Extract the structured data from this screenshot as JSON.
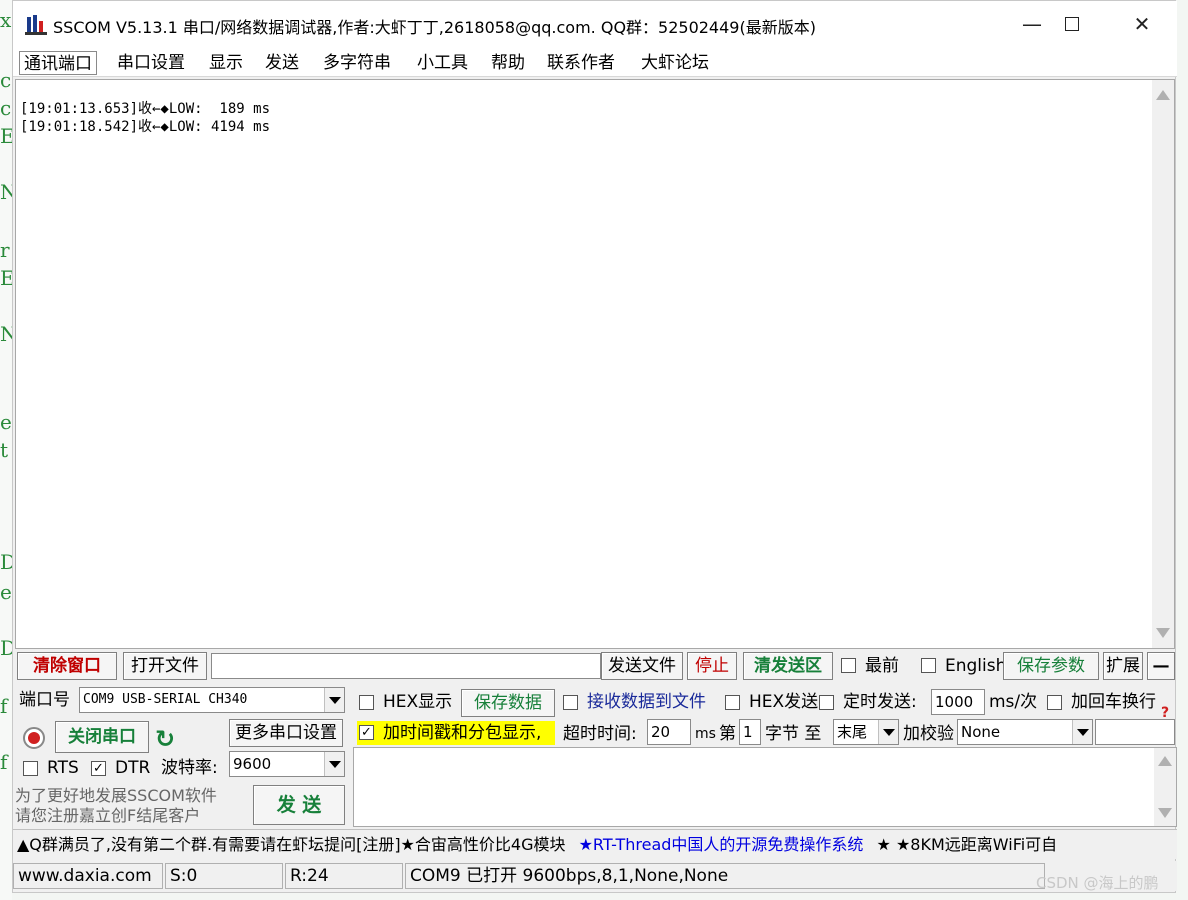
{
  "background_editor": {
    "left_chars": [
      "x",
      "c",
      "c",
      "E",
      "N",
      "r",
      "E",
      "N",
      "e",
      "t",
      "D",
      "e",
      "D",
      "f",
      "f"
    ]
  },
  "window": {
    "title": "SSCOM V5.13.1 串口/网络数据调试器,作者:大虾丁丁,2618058@qq.com. QQ群：52502449(最新版本)",
    "minimize_glyph": "—",
    "close_glyph": "✕"
  },
  "menu": {
    "items": [
      "通讯端口",
      "串口设置",
      "显示",
      "发送",
      "多字符串",
      "小工具",
      "帮助",
      "联系作者",
      "大虾论坛"
    ]
  },
  "receive": {
    "lines": [
      "[19:01:13.653]收←◆LOW:  189 ms",
      "[19:01:18.542]收←◆LOW: 4194 ms"
    ]
  },
  "toolbar": {
    "clear_window": "清除窗口",
    "open_file": "打开文件",
    "file_path": "",
    "send_file": "发送文件",
    "stop": "停止",
    "clear_send": "清发送区",
    "topmost": "最前",
    "english": "English",
    "save_params": "保存参数",
    "expand": "扩展",
    "collapse": "—"
  },
  "port": {
    "port_label": "端口号",
    "port_value": "COM9 USB-SERIAL CH340",
    "close_port": "关闭串口",
    "more_settings": "更多串口设置",
    "rts": "RTS",
    "dtr": "DTR",
    "baud_label": "波特率:",
    "baud_value": "9600",
    "promo_line1": "为了更好地发展SSCOM软件",
    "promo_line2": "请您注册嘉立创F结尾客户",
    "send_button": "发 送"
  },
  "options": {
    "hex_display": "HEX显示",
    "save_data": "保存数据",
    "recv_to_file": "接收数据到文件",
    "hex_send": "HEX发送",
    "timed_send": "定时发送:",
    "interval": "1000",
    "interval_unit": "ms/次",
    "add_crlf": "加回车换行",
    "timestamp": "加时间戳和分包显示,",
    "timeout_label": "超时时间:",
    "timeout_value": "20",
    "timeout_unit": "ms",
    "byte_prefix": "第",
    "byte_value": "1",
    "byte_suffix": "字节 至",
    "end_value": "末尾",
    "checksum_label": "加校验",
    "checksum_value": "None",
    "help_glyph": "?"
  },
  "ticker": {
    "part1": "▲Q群满员了,没有第二个群.有需要请在虾坛提问[注册]★合宙高性价比4G模块",
    "part2": "★RT-Thread中国人的开源免费操作系统",
    "part3": "★ ★8KM远距离WiFi可自"
  },
  "status": {
    "website": "www.daxia.com",
    "sent": "S:0",
    "received": "R:24",
    "port_status": "COM9 已打开  9600bps,8,1,None,None"
  },
  "watermark": "CSDN @海上的鹏",
  "colors": {
    "red_button": "#c00000",
    "green_button": "#17803a",
    "timestamp_highlight": "#ffff00",
    "ticker_blue": "#0000e0"
  }
}
